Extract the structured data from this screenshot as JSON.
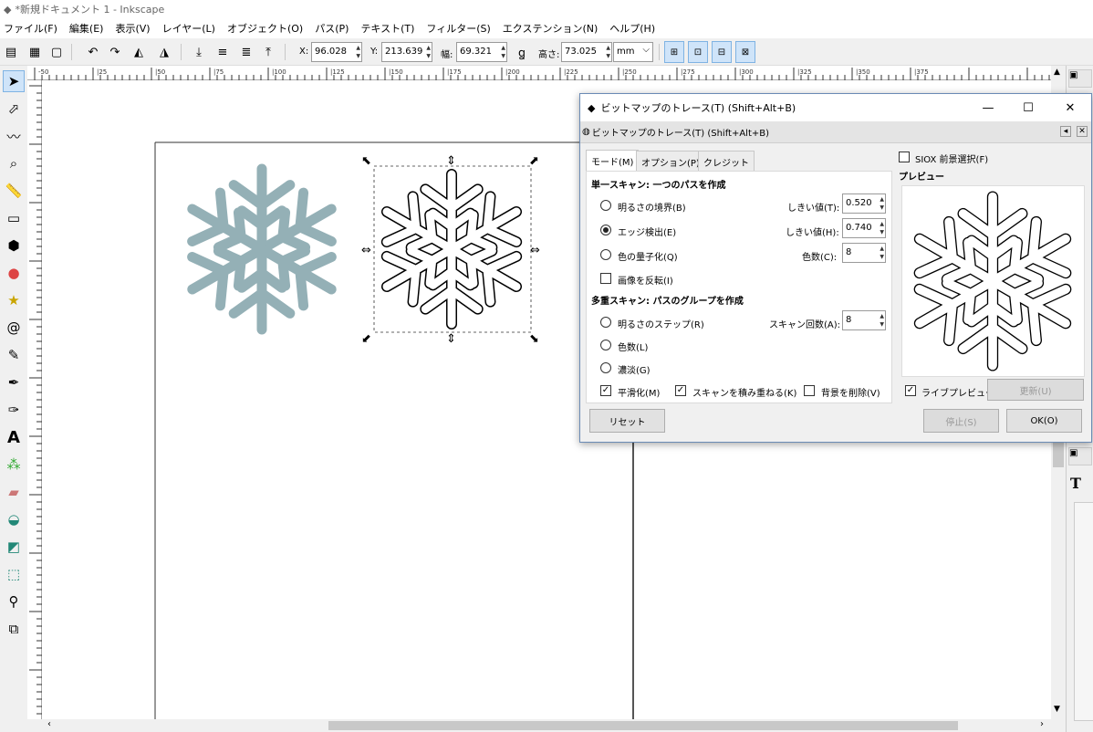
{
  "window": {
    "title": "*新規ドキュメント 1 - Inkscape"
  },
  "menu": [
    "ファイル(F)",
    "編集(E)",
    "表示(V)",
    "レイヤー(L)",
    "オブジェクト(O)",
    "パス(P)",
    "テキスト(T)",
    "フィルター(S)",
    "エクステンション(N)",
    "ヘルプ(H)"
  ],
  "toolbar": {
    "x_label": "X:",
    "x_value": "96.028",
    "y_label": "Y:",
    "y_value": "213.639",
    "w_label": "幅:",
    "w_value": "69.321",
    "h_label": "高さ:",
    "h_value": "73.025",
    "unit": "mm"
  },
  "ruler": {
    "h_ticks": [
      "-50",
      "|25",
      "|50",
      "|75",
      "|100",
      "|125",
      "|150",
      "|175",
      "|200",
      "|225",
      "|250",
      "|275",
      "|300",
      "|325",
      "|350",
      "|375"
    ]
  },
  "dialog": {
    "title": "ビットマップのトレース(T) (Shift+Alt+B)",
    "header": "ビットマップのトレース(T) (Shift+Alt+B)",
    "tabs": [
      "モード(M)",
      "オプション(P)",
      "クレジット"
    ],
    "single_title": "単一スキャン: 一つのパスを作成",
    "brightness": "明るさの境界(B)",
    "edge": "エッジ検出(E)",
    "color_quant": "色の量子化(Q)",
    "invert": "画像を反転(I)",
    "threshold_t_label": "しきい値(T):",
    "threshold_t": "0.520",
    "threshold_h_label": "しきい値(H):",
    "threshold_h": "0.740",
    "colors_c_label": "色数(C):",
    "colors_c": "8",
    "multi_title": "多重スキャン: パスのグループを作成",
    "bright_steps": "明るさのステップ(R)",
    "colors_l": "色数(L)",
    "grays": "濃淡(G)",
    "scans_label": "スキャン回数(A):",
    "scans": "8",
    "smooth": "平滑化(M)",
    "stack": "スキャンを積み重ねる(K)",
    "remove_bg": "背景を削除(V)",
    "siox": "SIOX 前景選択(F)",
    "preview_title": "プレビュー",
    "live_preview": "ライブプレビュー",
    "update": "更新(U)",
    "reset": "リセット",
    "stop": "停止(S)",
    "ok": "OK(O)"
  },
  "colors": {
    "snowflake": "#94b0b6",
    "accent": "#cfe4f9"
  }
}
